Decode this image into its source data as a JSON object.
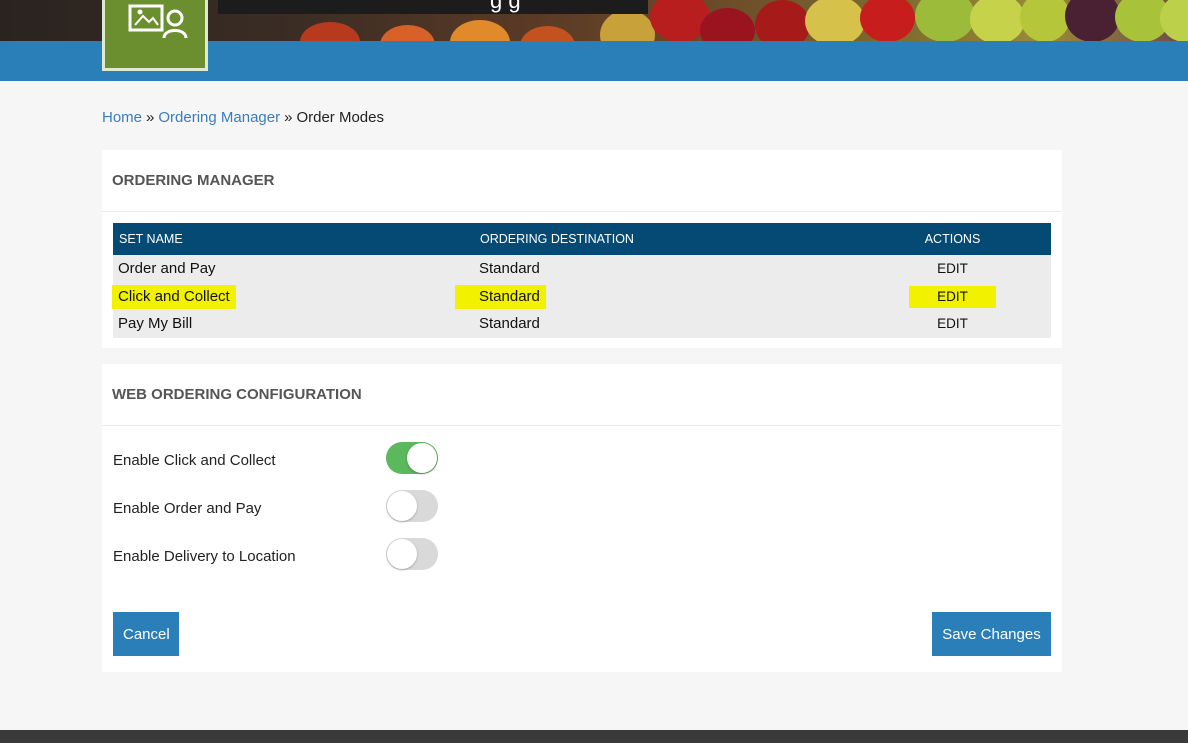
{
  "header": {
    "title_fragment": "g  g",
    "colors": {
      "bar": "#2b7fb9",
      "logo_bg": "#6b8f2e"
    },
    "logo_icon": "image-user-icon"
  },
  "breadcrumb": {
    "home": "Home",
    "separator": "»",
    "ordering_manager": "Ordering Manager",
    "current": "Order Modes"
  },
  "ordering_manager": {
    "title": "ORDERING MANAGER",
    "columns": [
      "SET NAME",
      "ORDERING DESTINATION",
      "ACTIONS"
    ],
    "rows": [
      {
        "set_name": "Order and Pay",
        "destination": "Standard",
        "action": "EDIT"
      },
      {
        "set_name": "Click and Collect",
        "destination": "Standard",
        "action": "EDIT",
        "highlighted": true
      },
      {
        "set_name": "Pay My Bill",
        "destination": "Standard",
        "action": "EDIT"
      }
    ],
    "colors": {
      "header_bg": "#044a74",
      "highlight": "#f2f200"
    }
  },
  "web_ordering": {
    "title": "WEB ORDERING CONFIGURATION",
    "toggles": [
      {
        "label": "Enable Click and Collect",
        "enabled": true
      },
      {
        "label": "Enable Order and Pay",
        "enabled": false
      },
      {
        "label": "Enable Delivery to Location",
        "enabled": false
      }
    ],
    "colors": {
      "on": "#5cb85c",
      "off": "#d9d9d9"
    },
    "cancel_label": "Cancel",
    "save_label": "Save Changes"
  }
}
